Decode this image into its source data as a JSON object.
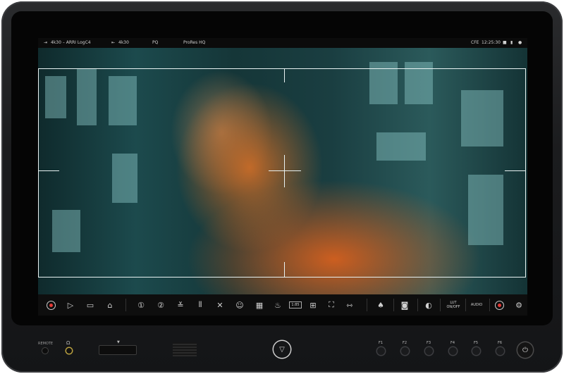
{
  "statusbar": {
    "input": "4k30 – ARRI LogC4",
    "output": "4k30",
    "hdr": "PQ",
    "codec": "ProRes HQ",
    "media": "CFE",
    "time": "12:25:30"
  },
  "toolbar": {
    "timecode_label": "1:85",
    "lut_label": "LUT\nON/OFF",
    "audio_label": "AUDIO"
  },
  "hardware": {
    "remote_label": "REMOTE",
    "fkeys": [
      "F1",
      "F2",
      "F3",
      "F4",
      "F5",
      "F6"
    ]
  },
  "colors": {
    "record": "#e53935",
    "accent": "#e8f2f2"
  }
}
